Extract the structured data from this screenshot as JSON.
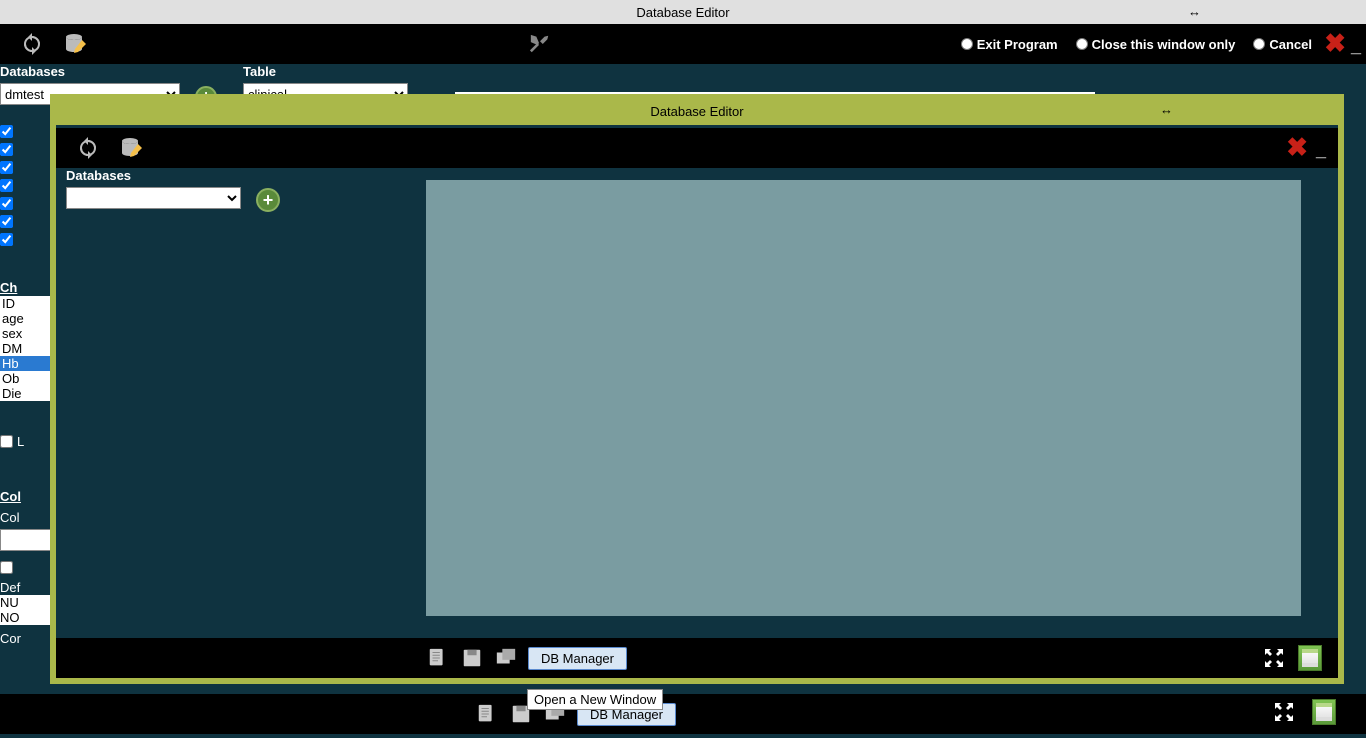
{
  "app_title": "Database Editor",
  "bg": {
    "radios": {
      "exit": "Exit Program",
      "close": "Close this window only",
      "cancel": "Cancel"
    },
    "labels": {
      "databases": "Databases",
      "table": "Table"
    },
    "db_value": "dmtest",
    "table_value": "clinical",
    "list_header": "Ch",
    "list_items": [
      "ID",
      "age",
      "sex",
      "DM",
      "Hb",
      "Ob",
      "Die"
    ],
    "list_selected": "Hb",
    "label_L": "L",
    "section2_hdr": "Col",
    "section2_sub": "Col",
    "def_label": "Def",
    "def_items": [
      "NU",
      "NO"
    ],
    "cor_label": "Cor"
  },
  "fg": {
    "title": "Database Editor",
    "databases_label": "Databases",
    "db_value": ""
  },
  "footer": {
    "db_manager": "DB Manager"
  },
  "tooltip": "Open a New Window"
}
